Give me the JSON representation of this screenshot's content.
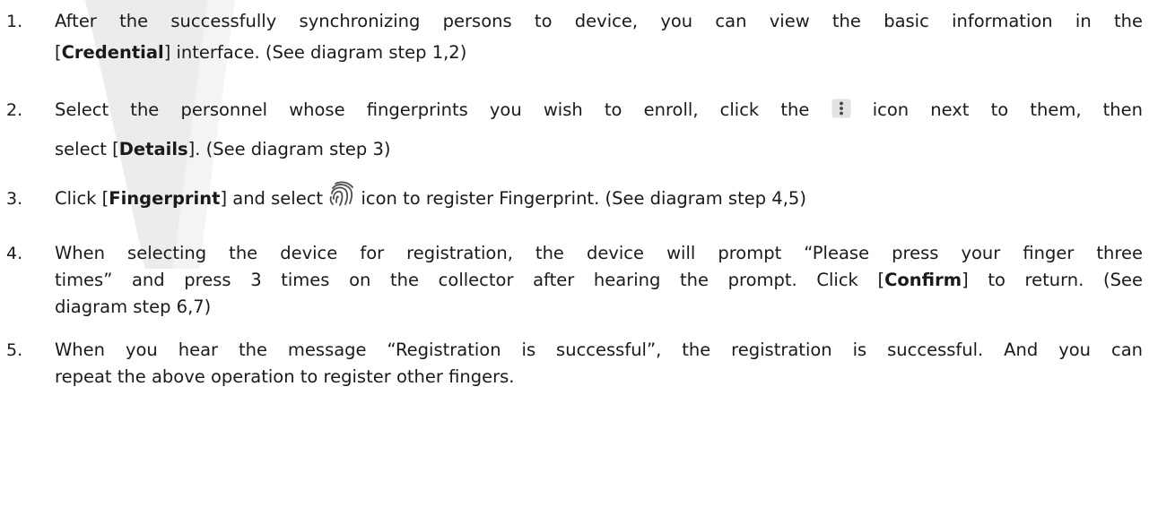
{
  "steps": [
    {
      "number": "1.",
      "line1": "After the successfully synchronizing persons to device, you can view the basic information in the",
      "line2_pre": "[",
      "line2_bold": "Credential",
      "line2_post": "] interface. (See diagram step 1,2)"
    },
    {
      "number": "2.",
      "line1_pre": "Select the personnel whose fingerprints you wish to enroll, click the",
      "line1_post": "icon next to them, then",
      "line2_pre": "select [",
      "line2_bold": "Details",
      "line2_post": "]. (See diagram step 3)",
      "icon": "more-vertical-icon"
    },
    {
      "number": "3.",
      "pre": "Click [",
      "bold": "Fingerprint",
      "mid": "] and select",
      "post": "icon to register Fingerprint. (See diagram step 4,5)",
      "icon": "fingerprint-icon"
    },
    {
      "number": "4.",
      "line1": "When selecting the device for registration, the device will prompt “Please press your finger three",
      "line2_pre": "times” and press 3 times on the collector after hearing the prompt. Click [",
      "line2_bold": "Confirm",
      "line2_post": "] to return. (See",
      "line3": "diagram step 6,7)"
    },
    {
      "number": "5.",
      "line1": "When you hear the message “Registration is successful”, the registration is successful. And you can",
      "line2": "repeat the above operation to register other fingers."
    }
  ]
}
